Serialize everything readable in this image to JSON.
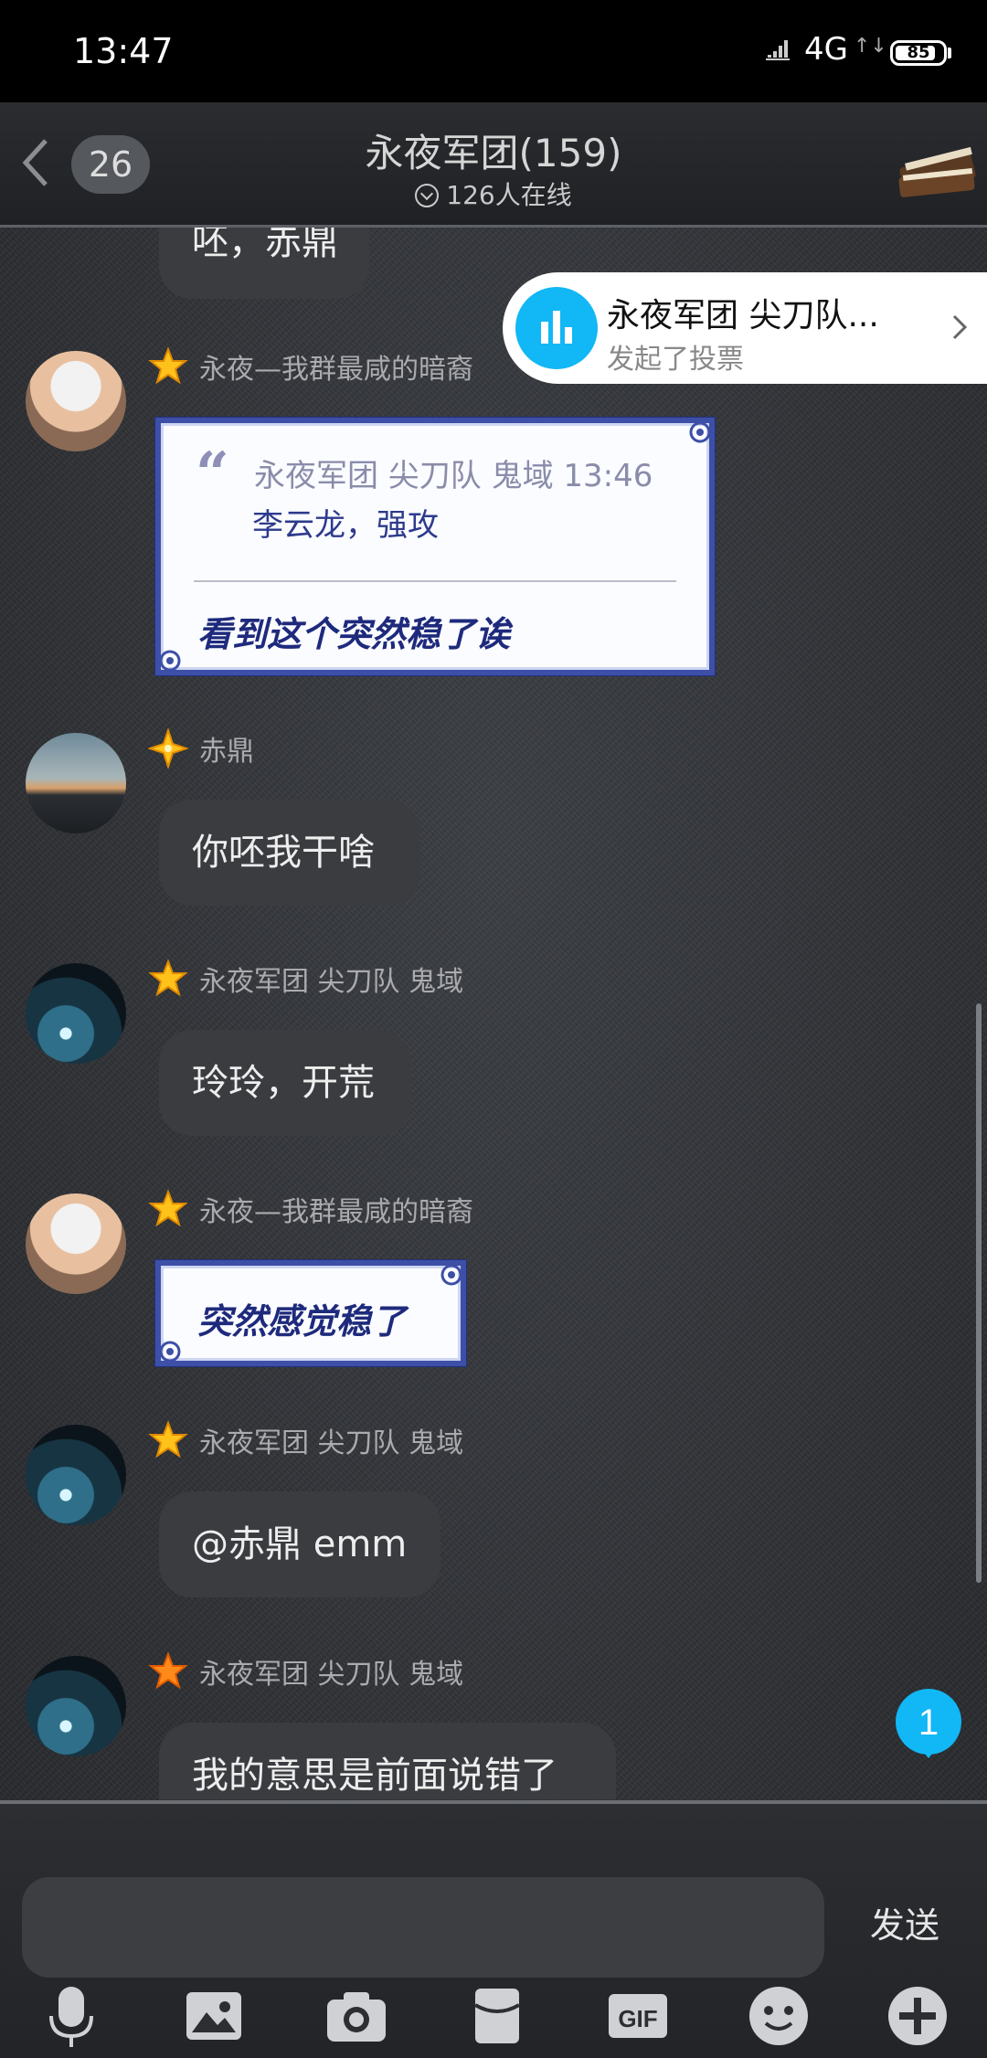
{
  "status_bar": {
    "time": "13:47",
    "network": "4G",
    "battery": "85",
    "battery_level_percent": 85
  },
  "header": {
    "unread_count": "26",
    "title": "永夜军团(159)",
    "online": "126人在线"
  },
  "vote_notification": {
    "title": "永夜军团 尖刀队...",
    "subtitle": "发起了投票"
  },
  "messages": [
    {
      "text": "呸，赤鼎"
    },
    {
      "sender": "永夜—我群最咸的暗裔",
      "quote": {
        "header": "永夜军团 尖刀队 鬼域 13:46",
        "text": "李云龙，强攻"
      },
      "text": "看到这个突然稳了诶"
    },
    {
      "sender": "赤鼎",
      "text": "你呸我干啥"
    },
    {
      "sender": "永夜军团 尖刀队 鬼域",
      "text": "玲玲，开荒"
    },
    {
      "sender": "永夜—我群最咸的暗裔",
      "text": "突然感觉稳了"
    },
    {
      "sender": "永夜军团 尖刀队 鬼域",
      "text": "@赤鼎 emm"
    },
    {
      "sender": "永夜军团 尖刀队 鬼域",
      "text": "我的意思是前面说错了"
    }
  ],
  "new_messages_badge": "1",
  "input": {
    "placeholder": "",
    "send_label": "发送"
  },
  "toolbar": [
    "microphone-icon",
    "image-icon",
    "camera-icon",
    "red-packet-icon",
    "gif-icon",
    "emoji-icon",
    "plus-icon"
  ],
  "colors": {
    "accent": "#12b7f5",
    "porcelain_border": "#3d4fa6",
    "star": "#ffc21a"
  }
}
